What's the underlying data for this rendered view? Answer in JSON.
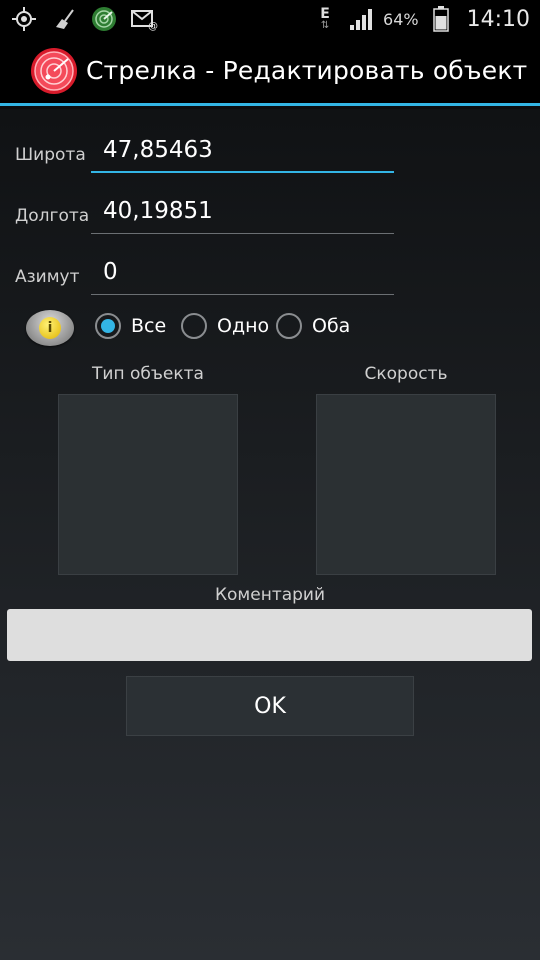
{
  "status_bar": {
    "icons": [
      "gps-icon",
      "broom-icon",
      "radar-app-icon",
      "mail-icon"
    ],
    "network_type": "E",
    "battery_percent": "64%",
    "time": "14:10"
  },
  "action_bar": {
    "title": "Стрелка - Редактировать объект",
    "icon": "radar-icon"
  },
  "form": {
    "latitude": {
      "label": "Широта",
      "value": "47,85463"
    },
    "longitude": {
      "label": "Долгота",
      "value": "40,19851"
    },
    "azimuth": {
      "label": "Азимут",
      "value": "0"
    }
  },
  "radio": {
    "options": [
      "Все",
      "Одно",
      "Оба"
    ],
    "selected": "Все"
  },
  "lists": {
    "object_type_label": "Тип объекта",
    "speed_label": "Скорость"
  },
  "comment": {
    "label": "Коментарий",
    "value": ""
  },
  "ok_button": {
    "label": "OK"
  },
  "colors": {
    "accent": "#33b5e5",
    "background": "#0b0c0e",
    "panel": "#2b3033"
  }
}
